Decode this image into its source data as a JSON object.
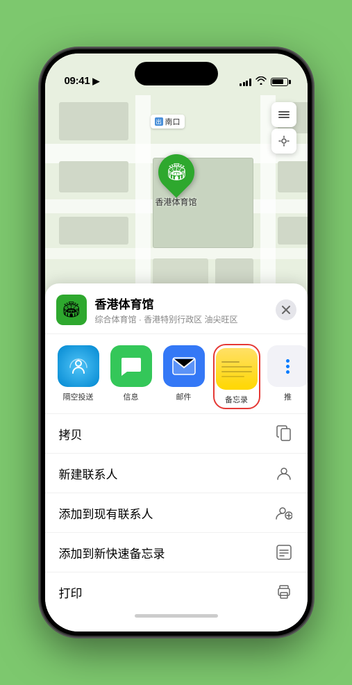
{
  "phone": {
    "status_bar": {
      "time": "09:41",
      "location_indicator": "▶"
    }
  },
  "map": {
    "label_text": "南口",
    "venue_name": "香港体育馆",
    "venue_name_label": "香港体育馆",
    "venue_subtitle": "综合体育馆 · 香港特别行政区 油尖旺区"
  },
  "sheet": {
    "venue_name": "香港体育馆",
    "venue_subtitle": "综合体育馆 · 香港特别行政区 油尖旺区",
    "close_label": "×",
    "share_apps": [
      {
        "id": "airdrop",
        "label": "隔空投送"
      },
      {
        "id": "messages",
        "label": "信息"
      },
      {
        "id": "mail",
        "label": "邮件"
      },
      {
        "id": "notes",
        "label": "备忘录"
      },
      {
        "id": "more",
        "label": "推"
      }
    ],
    "actions": [
      {
        "id": "copy",
        "label": "拷贝",
        "icon": "copy"
      },
      {
        "id": "new-contact",
        "label": "新建联系人",
        "icon": "person"
      },
      {
        "id": "add-contact",
        "label": "添加到现有联系人",
        "icon": "person-add"
      },
      {
        "id": "add-note",
        "label": "添加到新快速备忘录",
        "icon": "note"
      },
      {
        "id": "print",
        "label": "打印",
        "icon": "print"
      }
    ]
  }
}
